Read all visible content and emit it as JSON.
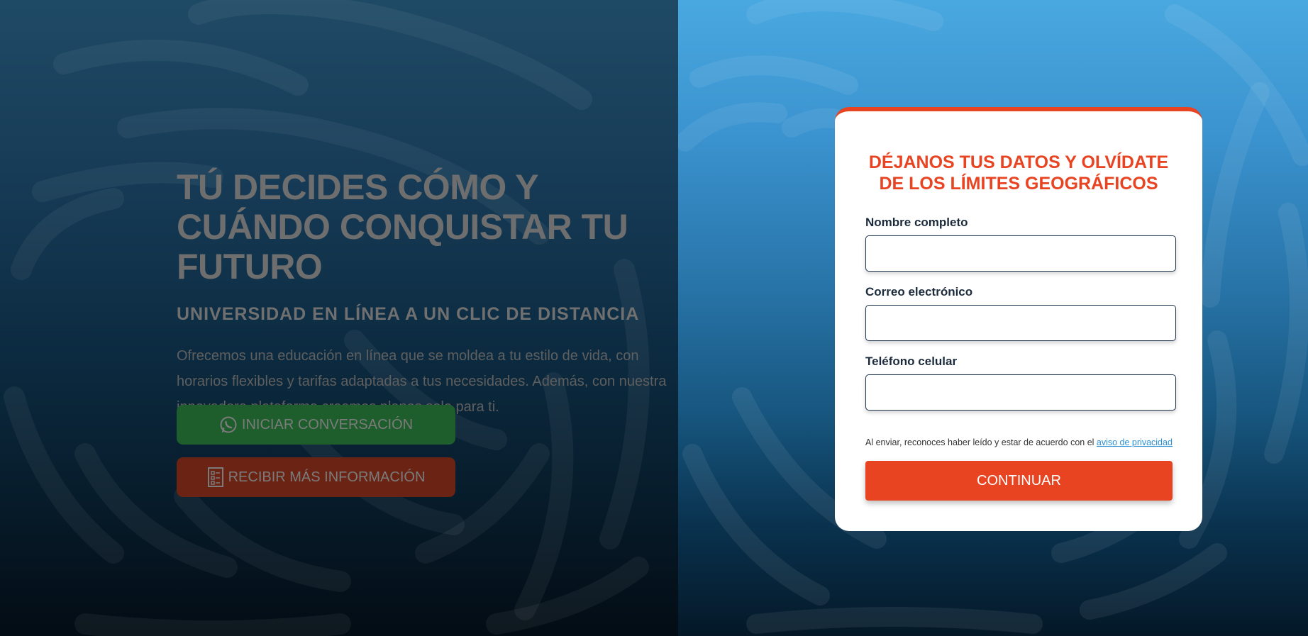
{
  "hero": {
    "title": "TÚ DECIDES CÓMO Y CUÁNDO CONQUISTAR TU FUTURO",
    "subtitle": "UNIVERSIDAD EN LÍNEA A UN CLIC DE DISTANCIA",
    "description": "Ofrecemos una educación en línea que se moldea a tu estilo de vida, con horarios flexibles y tarifas adaptadas a tus necesidades. Además, con nuestra innovadora plataforma creamos planes solo para ti."
  },
  "buttons": {
    "whatsapp_label": "INICIAR CONVERSACIÓN",
    "whatsapp_icon": "whatsapp-icon",
    "info_label": "RECIBIR MÁS INFORMACIÓN",
    "info_icon": "form-icon"
  },
  "form": {
    "title": "DÉJANOS TUS DATOS Y OLVÍDATE DE LOS LÍMITES GEOGRÁFICOS",
    "fields": [
      {
        "label": "Nombre completo",
        "value": ""
      },
      {
        "label": "Correo electrónico",
        "value": ""
      },
      {
        "label": "Teléfono celular",
        "value": ""
      }
    ],
    "privacy_text": "Al enviar, reconoces haber leído y estar de acuerdo con el ",
    "privacy_link": "aviso de privacidad",
    "submit_label": "CONTINUAR"
  },
  "colors": {
    "accent": "#e84422",
    "whatsapp_button": "#1e5e2c",
    "info_button": "#6b2414",
    "link": "#2a8fd4"
  }
}
